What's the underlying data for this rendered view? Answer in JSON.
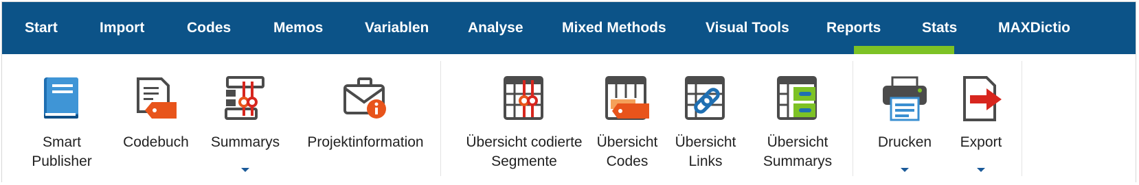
{
  "tabs": [
    {
      "label": "Start"
    },
    {
      "label": "Import"
    },
    {
      "label": "Codes"
    },
    {
      "label": "Memos"
    },
    {
      "label": "Variablen"
    },
    {
      "label": "Analyse"
    },
    {
      "label": "Mixed Methods"
    },
    {
      "label": "Visual Tools"
    },
    {
      "label": "Reports",
      "active": true
    },
    {
      "label": "Stats"
    },
    {
      "label": "MAXDictio"
    }
  ],
  "ribbon": {
    "smart_publisher": {
      "line1": "Smart",
      "line2": "Publisher",
      "icon": "book-icon"
    },
    "codebuch": {
      "line1": "Codebuch",
      "icon": "codebook-icon"
    },
    "summarys": {
      "line1": "Summarys",
      "icon": "summarys-icon",
      "has_dropdown": true
    },
    "projektinformation": {
      "line1": "Projektinformation",
      "icon": "briefcase-info-icon"
    },
    "uebersicht_segmente": {
      "line1": "Übersicht codierte",
      "line2": "Segmente",
      "icon": "segments-table-icon"
    },
    "uebersicht_codes": {
      "line1": "Übersicht",
      "line2": "Codes",
      "icon": "codes-table-icon"
    },
    "uebersicht_links": {
      "line1": "Übersicht",
      "line2": "Links",
      "icon": "links-table-icon"
    },
    "uebersicht_summarys": {
      "line1": "Übersicht",
      "line2": "Summarys",
      "icon": "summarys-table-icon"
    },
    "drucken": {
      "line1": "Drucken",
      "icon": "printer-icon",
      "has_dropdown": true
    },
    "export": {
      "line1": "Export",
      "icon": "export-icon",
      "has_dropdown": true
    }
  },
  "colors": {
    "topbar": "#0c5388",
    "active_underline": "#7dc225",
    "orange": "#e8541b",
    "red": "#d7261e",
    "blue_icon": "#3a8fd1",
    "green_icon": "#7dc225",
    "dark_icon": "#4b4b4b"
  }
}
